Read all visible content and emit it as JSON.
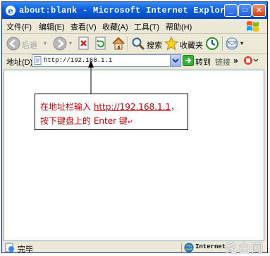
{
  "window": {
    "title": "about:blank - Microsoft Internet Explorer",
    "minimize": "_",
    "maximize": "□",
    "close": "✕"
  },
  "menu": {
    "items": [
      "文件(F)",
      "编辑(E)",
      "查看(V)",
      "收藏(A)",
      "工具(T)",
      "帮助(H)"
    ]
  },
  "toolbar": {
    "back_label": "后退",
    "search_label": "搜索",
    "favorites_label": "收藏夹"
  },
  "address": {
    "label": "地址(D)",
    "value": "http://192.168.1.1",
    "go_label": "转到",
    "links_label": "链接",
    "more": "»"
  },
  "status": {
    "text": "完毕",
    "zone": "Internet"
  },
  "annotation": {
    "line1_prefix": "在地址栏输入 ",
    "line1_url": "http://192.168.1.1",
    "line1_suffix": "，",
    "line2": "按下键盘上的 Enter 键"
  },
  "watermark": "路由网",
  "colors": {
    "annotation_text": "#c00000",
    "titlebar": "#0a5fd8"
  }
}
